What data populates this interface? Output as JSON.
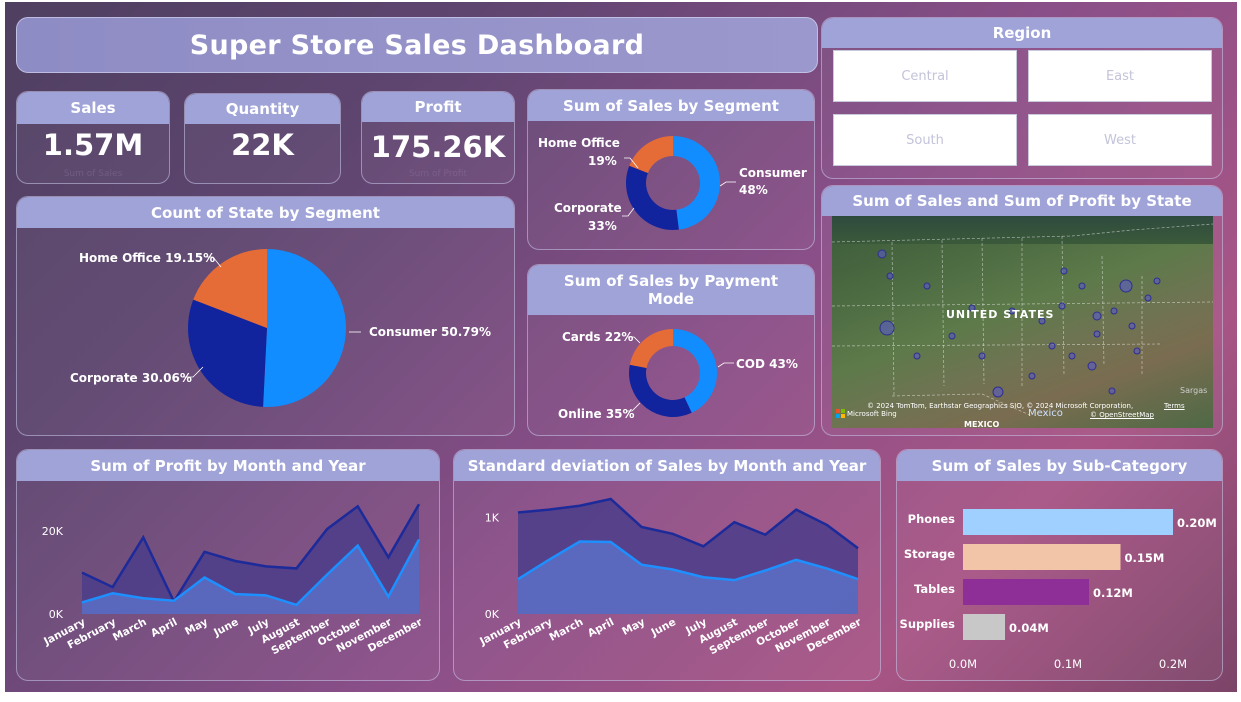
{
  "title": "Super Store  Sales Dashboard",
  "kpis": {
    "sales": {
      "label": "Sales",
      "value": "1.57M",
      "sub": "Sum of Sales"
    },
    "quantity": {
      "label": "Quantity",
      "value": "22K",
      "sub": ""
    },
    "profit": {
      "label": "Profit",
      "value": "175.26K",
      "sub": "Sum of Profit"
    }
  },
  "region": {
    "title": "Region",
    "options": [
      "Central",
      "East",
      "South",
      "West"
    ]
  },
  "segment_donut": {
    "title": "Sum of Sales by Segment",
    "labels": [
      {
        "name": "Home Office",
        "pct": "19%"
      },
      {
        "name": "Corporate",
        "pct": "33%"
      },
      {
        "name": "Consumer",
        "pct": "48%"
      }
    ]
  },
  "payment_donut": {
    "title_line1": "Sum of Sales by Payment",
    "title_line2": "Mode",
    "labels": [
      {
        "text": "Cards 22%"
      },
      {
        "text": "COD 43%"
      },
      {
        "text": "Online 35%"
      }
    ]
  },
  "state_pie": {
    "title": "Count of State by Segment",
    "labels": [
      {
        "text": "Home Office 19.15%"
      },
      {
        "text": "Consumer 50.79%"
      },
      {
        "text": "Corporate 30.06%"
      }
    ]
  },
  "map": {
    "title": "Sum of Sales and Sum of Profit by State",
    "country": "UNITED STATES",
    "mexico": "Mexico",
    "mexico2": "MEXICO",
    "sargas": "Sargas",
    "attribution": "© 2024 TomTom, Earthstar Geographics SIO, © 2024 Microsoft Corporation,",
    "terms": "Terms",
    "osm": "© OpenStreetMap",
    "bing": "Microsoft Bing"
  },
  "profit_chart": {
    "title": "Sum of Profit by Month and Year"
  },
  "std_chart": {
    "title": "Standard deviation of Sales by Month and Year"
  },
  "subcat_chart": {
    "title": "Sum of Sales by Sub-Category"
  },
  "colors": {
    "consumer": "#118dff",
    "corporate": "#12239e",
    "home_office": "#e66c37",
    "header": "#9fa3d8"
  },
  "chart_data": [
    {
      "type": "pie",
      "title": "Sum of Sales by Segment",
      "categories": [
        "Consumer",
        "Corporate",
        "Home Office"
      ],
      "values": [
        48,
        33,
        19
      ],
      "donut": true
    },
    {
      "type": "pie",
      "title": "Sum of Sales by Payment Mode",
      "categories": [
        "COD",
        "Online",
        "Cards"
      ],
      "values": [
        43,
        35,
        22
      ],
      "donut": true
    },
    {
      "type": "pie",
      "title": "Count of State by Segment",
      "categories": [
        "Consumer",
        "Corporate",
        "Home Office"
      ],
      "values": [
        50.79,
        30.06,
        19.15
      ]
    },
    {
      "type": "area",
      "title": "Sum of Profit by Month and Year",
      "categories": [
        "January",
        "February",
        "March",
        "April",
        "May",
        "June",
        "July",
        "August",
        "September",
        "October",
        "November",
        "December"
      ],
      "yticks": [
        "0K",
        "20K"
      ],
      "ylim": [
        0,
        28000
      ],
      "series": [
        {
          "values": [
            10000,
            6500,
            18500,
            3000,
            15000,
            12800,
            11500,
            11000,
            20500,
            26000,
            13700,
            26500
          ]
        },
        {
          "values": [
            2800,
            5000,
            3800,
            3200,
            8800,
            4800,
            4500,
            2200,
            9500,
            16500,
            4200,
            18000
          ]
        }
      ]
    },
    {
      "type": "area",
      "title": "Standard deviation of Sales by Month and Year",
      "categories": [
        "January",
        "February",
        "March",
        "April",
        "May",
        "June",
        "July",
        "August",
        "September",
        "October",
        "November",
        "December"
      ],
      "yticks": [
        "0K",
        "1K"
      ],
      "ylim": [
        0,
        1200
      ],
      "series": [
        {
          "values": [
            1050,
            1080,
            1120,
            1190,
            900,
            830,
            700,
            950,
            820,
            1080,
            920,
            680
          ]
        },
        {
          "values": [
            360,
            560,
            750,
            745,
            510,
            460,
            380,
            350,
            450,
            560,
            470,
            360
          ]
        }
      ]
    },
    {
      "type": "bar",
      "title": "Sum of Sales by Sub-Category",
      "categories": [
        "Phones",
        "Storage",
        "Tables",
        "Supplies"
      ],
      "values": [
        0.2,
        0.15,
        0.12,
        0.04
      ],
      "value_labels": [
        "0.20M",
        "0.15M",
        "0.12M",
        "0.04M"
      ],
      "colors": [
        "#9fd0ff",
        "#f2c4a8",
        "#8e2f97",
        "#c8c8c8"
      ],
      "xticks": [
        "0.0M",
        "0.1M",
        "0.2M"
      ],
      "xlim": [
        0,
        0.2
      ]
    }
  ]
}
